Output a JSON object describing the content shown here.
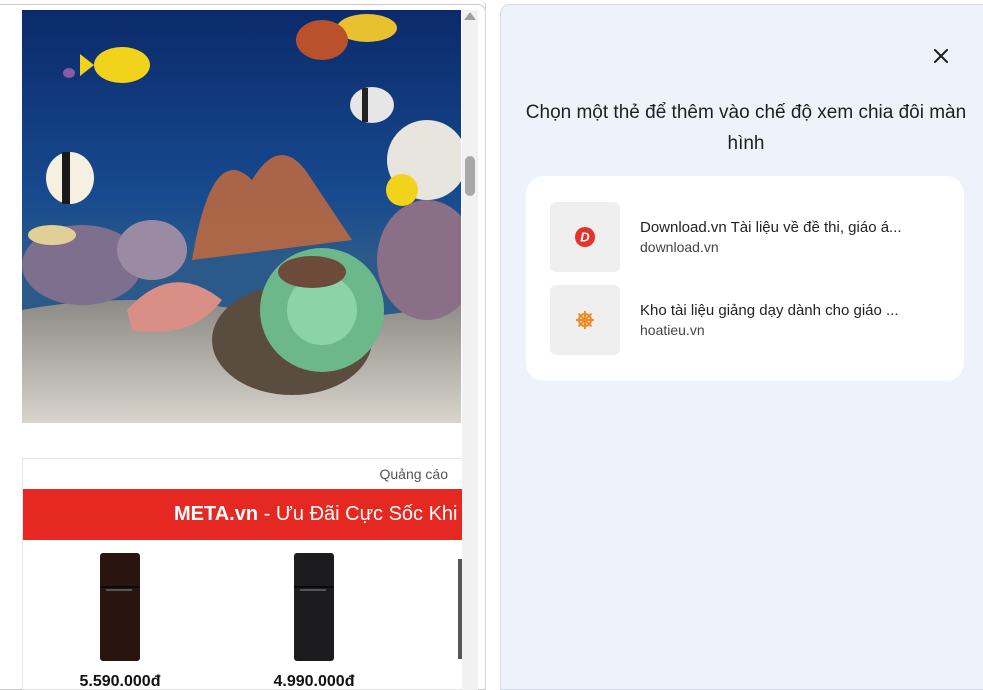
{
  "left": {
    "ad_label": "Quảng cáo",
    "ad_banner_brand": "META.vn",
    "ad_banner_text": " - Ưu Đãi Cực Sốc Khi",
    "products": [
      {
        "price": "5.590.000đ",
        "color": "#2a1410"
      },
      {
        "price": "4.990.000đ",
        "color": "#1c1c1e"
      }
    ]
  },
  "split_picker": {
    "title": "Chọn một thẻ để thêm vào chế độ xem chia đôi màn hình",
    "close_icon": "close-icon",
    "tabs": [
      {
        "title": "Download.vn Tài liệu về đề thi, giáo á...",
        "url": "download.vn",
        "icon": "download-vn-icon",
        "icon_color": "#e4332b"
      },
      {
        "title": "Kho tài liệu giảng dạy dành cho giáo ...",
        "url": "hoatieu.vn",
        "icon": "ship-wheel-icon",
        "icon_color": "#f08a24"
      }
    ]
  }
}
